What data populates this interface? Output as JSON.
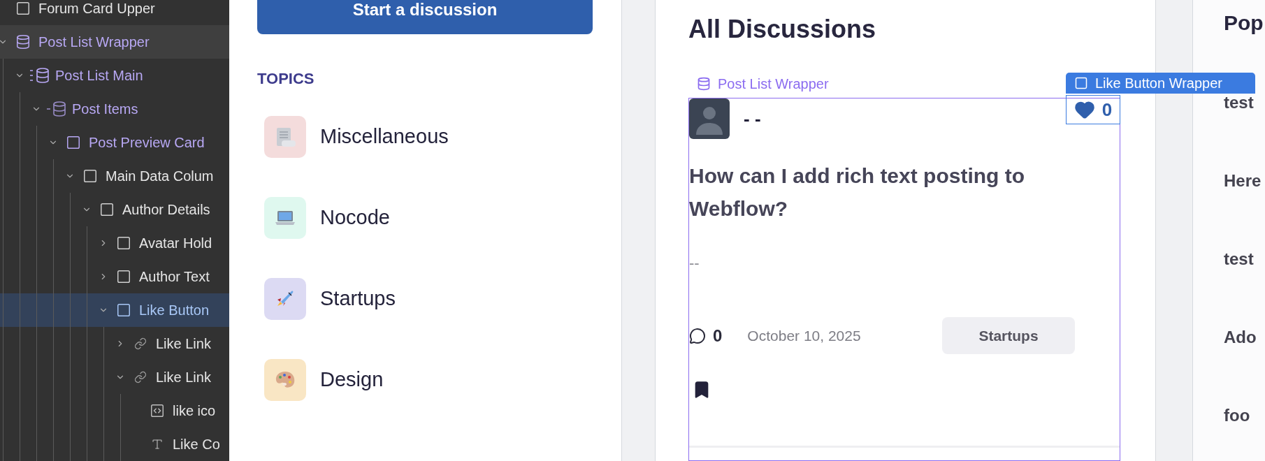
{
  "navigator": {
    "items": [
      {
        "label": "Forum Card Upper",
        "kind": "box",
        "bound": false,
        "selected": false,
        "hovered": false
      },
      {
        "label": "Post List Wrapper",
        "kind": "collection-wrapper",
        "expanded": true,
        "bound": true,
        "selected": false,
        "hovered": true,
        "children": [
          {
            "label": "Post List Main",
            "kind": "collection-list",
            "expanded": true,
            "bound": true,
            "selected": false,
            "hovered": false,
            "children": [
              {
                "label": "Post Items",
                "kind": "collection-item",
                "expanded": true,
                "bound": true,
                "selected": false,
                "hovered": false,
                "children": [
                  {
                    "label": "Post Preview Card",
                    "kind": "box",
                    "expanded": true,
                    "bound": true,
                    "selected": false,
                    "hovered": false,
                    "children": [
                      {
                        "label": "Main Data Colum",
                        "kind": "box",
                        "expanded": true,
                        "bound": false,
                        "selected": false,
                        "hovered": false,
                        "children": [
                          {
                            "label": "Author Details",
                            "kind": "box",
                            "expanded": true,
                            "bound": false,
                            "selected": false,
                            "hovered": false,
                            "children": [
                              {
                                "label": "Avatar Hold",
                                "kind": "box",
                                "expanded": false,
                                "bound": false,
                                "selected": false,
                                "hovered": false
                              },
                              {
                                "label": "Author Text",
                                "kind": "box",
                                "expanded": false,
                                "bound": false,
                                "selected": false,
                                "hovered": false
                              },
                              {
                                "label": "Like Button",
                                "kind": "box",
                                "expanded": true,
                                "bound": false,
                                "selected": true,
                                "hovered": false,
                                "children": [
                                  {
                                    "label": "Like Link",
                                    "kind": "link",
                                    "expanded": false,
                                    "bound": false,
                                    "selected": false,
                                    "hovered": false
                                  },
                                  {
                                    "label": "Like Link",
                                    "kind": "link",
                                    "expanded": true,
                                    "bound": false,
                                    "selected": false,
                                    "hovered": false,
                                    "children": [
                                      {
                                        "label": "like ico",
                                        "kind": "embed",
                                        "bound": false,
                                        "selected": false,
                                        "hovered": false
                                      },
                                      {
                                        "label": "Like Co",
                                        "kind": "text",
                                        "bound": false,
                                        "selected": false,
                                        "hovered": false
                                      }
                                    ]
                                  }
                                ]
                              }
                            ]
                          }
                        ]
                      }
                    ]
                  }
                ]
              }
            ]
          }
        ]
      }
    ]
  },
  "canvas": {
    "start_button": "Start a discussion",
    "topics": {
      "heading": "TOPICS",
      "items": [
        {
          "label": "Miscellaneous",
          "kind": "scroll",
          "color": "#f4dcdc"
        },
        {
          "label": "Nocode",
          "kind": "laptop",
          "color": "#dff8ef"
        },
        {
          "label": "Startups",
          "kind": "rocket",
          "color": "#dcdaf3"
        },
        {
          "label": "Design",
          "kind": "palette",
          "color": "#f9e6c4"
        }
      ]
    },
    "feed": {
      "title": "All Discussions",
      "selection_label": "Post List Wrapper",
      "like_label": "Like Button Wrapper",
      "post": {
        "author": "- -",
        "title": "How can I add rich text posting to Webflow?",
        "excerpt": "--",
        "comments": "0",
        "date": "October 10, 2025",
        "tag": "Startups",
        "likes": "0",
        "liked": true,
        "bookmarked": true
      }
    },
    "sidebar": {
      "heading": "Pop",
      "items": [
        "test",
        "Here",
        "test",
        "Ado",
        "foo"
      ]
    }
  }
}
